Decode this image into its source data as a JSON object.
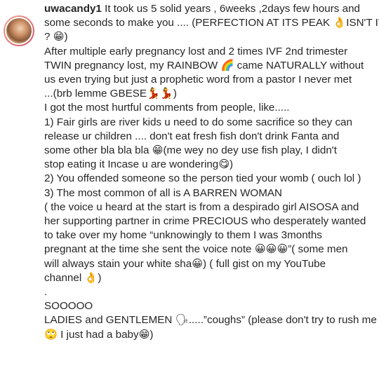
{
  "post": {
    "username": "uwacandy1",
    "caption_lines": [
      " It took us 5 solid years , 6weeks ,2days few hours and",
      "some seconds to make you .... (PERFECTION AT ITS PEAK 👌ISN'T IT",
      "? 😁)",
      "After multiple early pregnancy lost and 2 times IVF 2nd trimester",
      "TWIN pregnancy lost, my RAINBOW 🌈 came NATURALLY without",
      "us even trying but just a prophetic word from a pastor I never met",
      "...(brb lemme GBESE💃💃)",
      "I got the most hurtful comments from people, like.....",
      "1) Fair girls are river kids u need to do some sacrifice so they can",
      "release ur children .... don't eat fresh fish don't drink Fanta and",
      "some other bla bla bla 😁(me wey no dey use fish play, I didn't",
      "stop eating it Incase u are wondering😋)",
      "2) You offended someone so the person tied your womb ( ouch lol )",
      "3) The most common of all is A BARREN WOMAN",
      "( the voice u heard at the start is from a despirado girl AISOSA and",
      "her supporting partner in crime PRECIOUS who desperately wanted",
      "to take over my home “unknowingly to them I was 3months",
      "pregnant at the time she sent the voice note 😀😀😀”( some men",
      "will always stain your white sha😀) ( full gist on my YouTube",
      "channel 👌)",
      ".",
      "SOOOOO",
      "LADIES and GENTLEMEN 🗣.....”coughs” (please don't try to rush me",
      "🙄 I just had a baby😁)"
    ]
  }
}
